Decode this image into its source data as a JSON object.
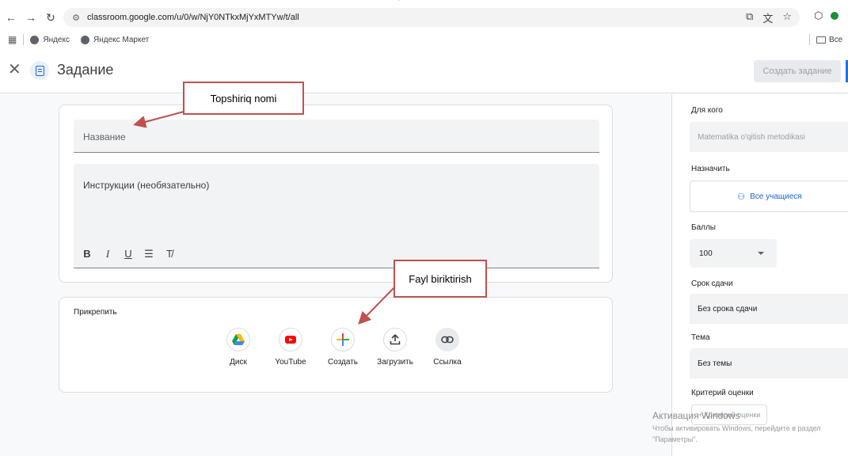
{
  "browser": {
    "url": "classroom.google.com/u/0/w/NjY0NTkxMjYxMTYw/t/all",
    "bookmarks": [
      "Яндекс",
      "Яндекс Маркет"
    ],
    "bookmarks_right": "Все"
  },
  "header": {
    "title": "Задание",
    "create_button": "Создать задание"
  },
  "form": {
    "title_placeholder": "Название",
    "instructions_placeholder": "Инструкции (необязательно)",
    "format_tools": [
      "B",
      "I",
      "U",
      "☰",
      "T̸"
    ]
  },
  "attach": {
    "label": "Прикрепить",
    "items": [
      {
        "label": "Диск",
        "icon": "google-drive-icon"
      },
      {
        "label": "YouTube",
        "icon": "youtube-icon"
      },
      {
        "label": "Создать",
        "icon": "create-plus-icon"
      },
      {
        "label": "Загрузить",
        "icon": "upload-icon"
      },
      {
        "label": "Ссылка",
        "icon": "link-icon"
      }
    ]
  },
  "sidebar": {
    "for_label": "Для кого",
    "for_value": "Matematika o'qitish metodikasi",
    "assign_label": "Назначить",
    "assign_value": "Все учащиеся",
    "points_label": "Баллы",
    "points_value": "100",
    "due_label": "Срок сдачи",
    "due_value": "Без срока сдачи",
    "topic_label": "Тема",
    "topic_value": "Без темы",
    "rubric_label": "Критерий оценки",
    "rubric_button": "+ Критерий оценки"
  },
  "watermark": {
    "line1": "Активация Windows",
    "line2": "Чтобы активировать Windows, перейдите в раздел",
    "line3": "\"Параметры\"."
  },
  "annotations": {
    "title_note": "Topshiriq nomi",
    "file_note": "Fayl biriktirish",
    "color": "#c0504d"
  }
}
